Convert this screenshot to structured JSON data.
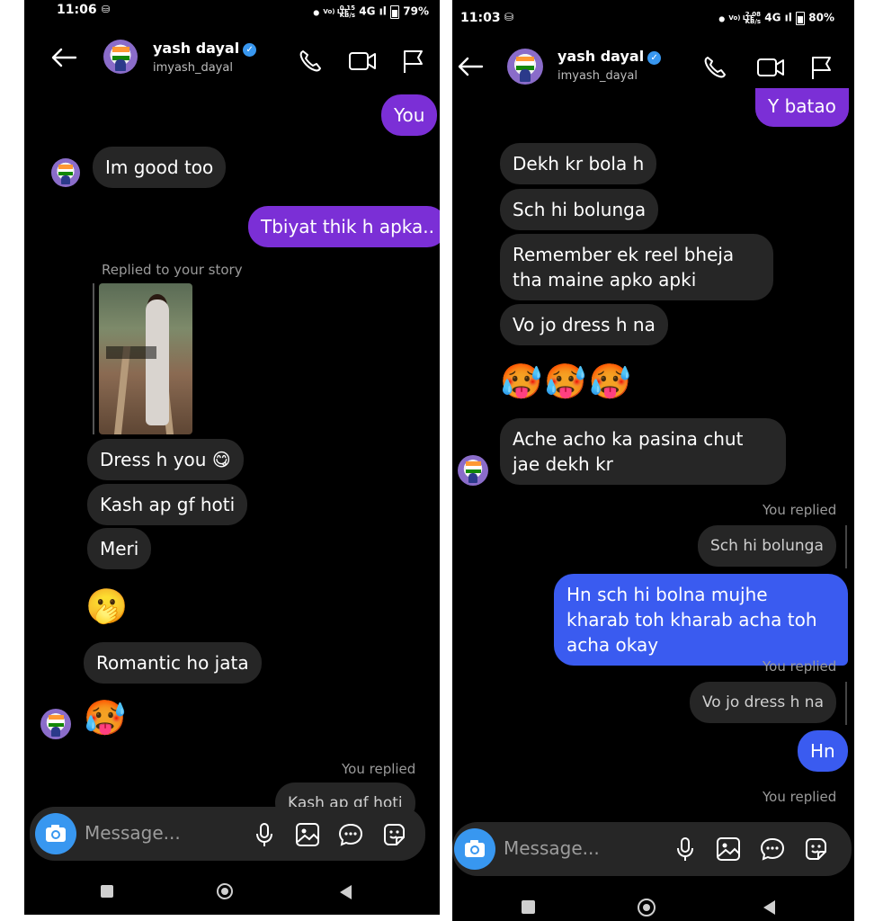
{
  "left": {
    "status": {
      "time": "11:06",
      "volte": "Vo) LTE",
      "speed_value": "0.15",
      "speed_unit": "KB/s",
      "network": "4G",
      "battery": "79%"
    },
    "header": {
      "name": "yash dayal",
      "handle": "imyash_dayal"
    },
    "messages": {
      "m1": "You",
      "m2": "Im good too",
      "m3": "Tbiyat thik h apka..",
      "story_label": "Replied to your story",
      "m4": "Dress h you 😋",
      "m5": "Kash ap gf hoti",
      "m6": "Meri",
      "e1": "🫢",
      "m7": "Romantic ho jata",
      "e2": "🥵",
      "you_replied": "You replied",
      "quote": "Kash ap gf hoti"
    },
    "composer": {
      "placeholder": "Message..."
    }
  },
  "right": {
    "status": {
      "time": "11:03",
      "volte": "Vo) LTE",
      "speed_value": "2.08",
      "speed_unit": "KB/s",
      "network": "4G",
      "battery": "80%"
    },
    "header": {
      "name": "yash dayal",
      "handle": "imyash_dayal"
    },
    "messages": {
      "m1": "Y batao",
      "m2": "Dekh kr bola h",
      "m3": "Sch hi bolunga",
      "m4": "Remember ek reel bheja tha maine apko apki",
      "m5": "Vo jo dress h na",
      "e1": "🥵🥵🥵",
      "m6": "Ache acho ka pasina chut jae dekh kr",
      "you_replied_1": "You replied",
      "quote_1": "Sch hi bolunga",
      "m7": "Hn sch hi bolna mujhe kharab toh kharab acha toh acha okay",
      "you_replied_2": "You replied",
      "quote_2": "Vo jo dress h na",
      "m8": "Hn",
      "you_replied_3": "You replied"
    },
    "composer": {
      "placeholder": "Message..."
    }
  },
  "colors": {
    "sent_purple": "#7b2fd6",
    "sent_blue": "#3a5bf0",
    "received": "#262626",
    "accent": "#3897f0"
  },
  "icons": [
    "back-arrow-icon",
    "phone-icon",
    "video-icon",
    "flag-icon",
    "verified-icon",
    "camera-icon",
    "microphone-icon",
    "gallery-icon",
    "chat-bubble-icon",
    "sticker-icon",
    "nav-recent-icon",
    "nav-home-icon",
    "nav-back-icon"
  ]
}
